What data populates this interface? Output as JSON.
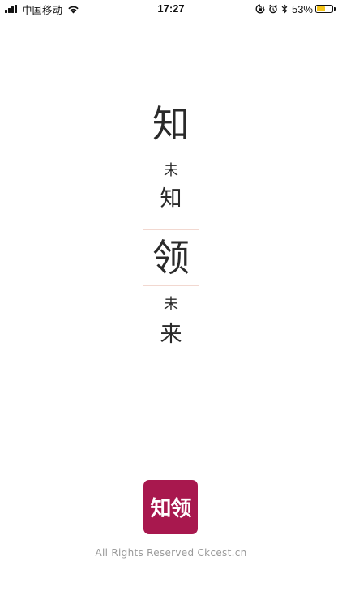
{
  "status_bar": {
    "carrier": "中国移动",
    "time": "17:27",
    "battery_percent": "53%",
    "battery_level": 0.53,
    "battery_color": "#f5c518",
    "icons": [
      "signal-icon",
      "wifi-icon",
      "orientation-lock-icon",
      "alarm-icon",
      "bluetooth-icon",
      "battery-icon"
    ]
  },
  "hero": {
    "box_char_1": "知",
    "small_char_1": "未",
    "mid_char_1": "知",
    "box_char_2": "领",
    "small_char_2": "未",
    "mid_char_2": "来",
    "box_border_color": "#f2d8d0"
  },
  "footer": {
    "logo_text": "知领",
    "logo_color": "#a8184e",
    "copyright": "All Rights Reserved Ckcest.cn"
  }
}
